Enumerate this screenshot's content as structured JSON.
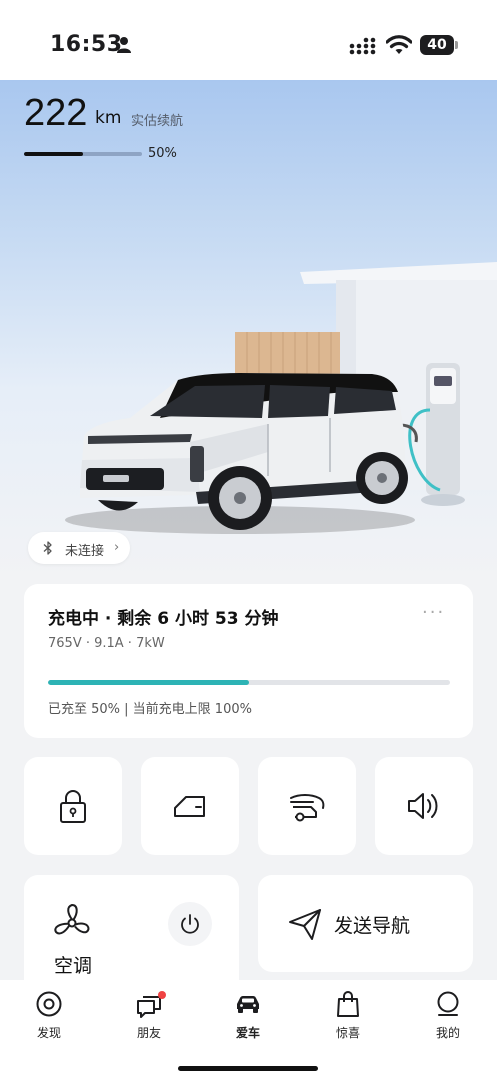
{
  "status_bar": {
    "time": "16:53",
    "battery": "40",
    "icons": [
      "person-icon",
      "signal-icon",
      "wifi-icon",
      "battery-icon"
    ]
  },
  "range": {
    "value": "222",
    "unit": "km",
    "label": "实估续航",
    "battery_percent_text": "50%",
    "battery_level": 0.5
  },
  "bluetooth": {
    "label": "未连接",
    "chevron": "›",
    "icon": "bluetooth-icon"
  },
  "charging": {
    "title": "充电中 · 剩余 6 小时 53 分钟",
    "details": "765V · 9.1A · 7kW",
    "progress": 0.5,
    "footer": "已充至 50% | 当前充电上限 100%",
    "more": "···",
    "accent_color": "#2db3b5"
  },
  "controls": {
    "tiles": [
      {
        "name": "lock",
        "icon": "lock-icon"
      },
      {
        "name": "door",
        "icon": "car-door-icon"
      },
      {
        "name": "trunk",
        "icon": "trunk-icon"
      },
      {
        "name": "horn",
        "icon": "speaker-icon"
      }
    ],
    "ac": {
      "label": "空调",
      "icon": "fan-icon",
      "power_icon": "power-icon"
    },
    "navigation": {
      "label": "发送导航",
      "icon": "send-navigation-icon"
    }
  },
  "tabs": [
    {
      "label": "发现",
      "icon": "discover-icon",
      "active": false,
      "badge": false
    },
    {
      "label": "朋友",
      "icon": "chat-icon",
      "active": false,
      "badge": true
    },
    {
      "label": "爱车",
      "icon": "car-icon",
      "active": true,
      "badge": false
    },
    {
      "label": "惊喜",
      "icon": "shopping-bag-icon",
      "active": false,
      "badge": false
    },
    {
      "label": "我的",
      "icon": "profile-icon",
      "active": false,
      "badge": false
    }
  ]
}
